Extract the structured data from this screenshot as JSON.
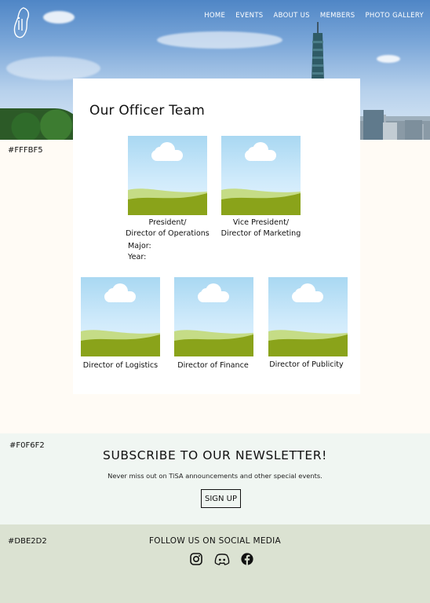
{
  "nav": {
    "items": [
      {
        "label": "HOME"
      },
      {
        "label": "EVENTS"
      },
      {
        "label": "ABOUT US"
      },
      {
        "label": "MEMBERS"
      },
      {
        "label": "PHOTO GALLERY"
      }
    ]
  },
  "hex_labels": {
    "main": "#FFFBF5",
    "newsletter": "#F0F6F2",
    "social": "#DBE2D2"
  },
  "team": {
    "title": "Our Officer Team",
    "officers": [
      {
        "role_line1": "President/",
        "role_line2": "Director of Operations",
        "major": "Major:",
        "year": "Year:"
      },
      {
        "role_line1": "Vice President/",
        "role_line2": "Director of Marketing"
      },
      {
        "role_line1": "Director of Logistics"
      },
      {
        "role_line1": "Director of Finance"
      },
      {
        "role_line1": "Director of Publicity"
      }
    ]
  },
  "newsletter": {
    "title": "SUBSCRIBE TO OUR NEWSLETTER!",
    "subtitle": "Never miss out on TiSA announcements and other special events.",
    "button": "SIGN UP"
  },
  "social": {
    "title": "FOLLOW US ON SOCIAL MEDIA",
    "icons": [
      "instagram-icon",
      "discord-icon",
      "facebook-icon"
    ]
  },
  "colors": {
    "main_bg": "#FFFBF5",
    "newsletter_bg": "#F0F6F2",
    "social_bg": "#DBE2D2",
    "grass": "#8aa31a",
    "grass_light": "#c5dc86"
  }
}
